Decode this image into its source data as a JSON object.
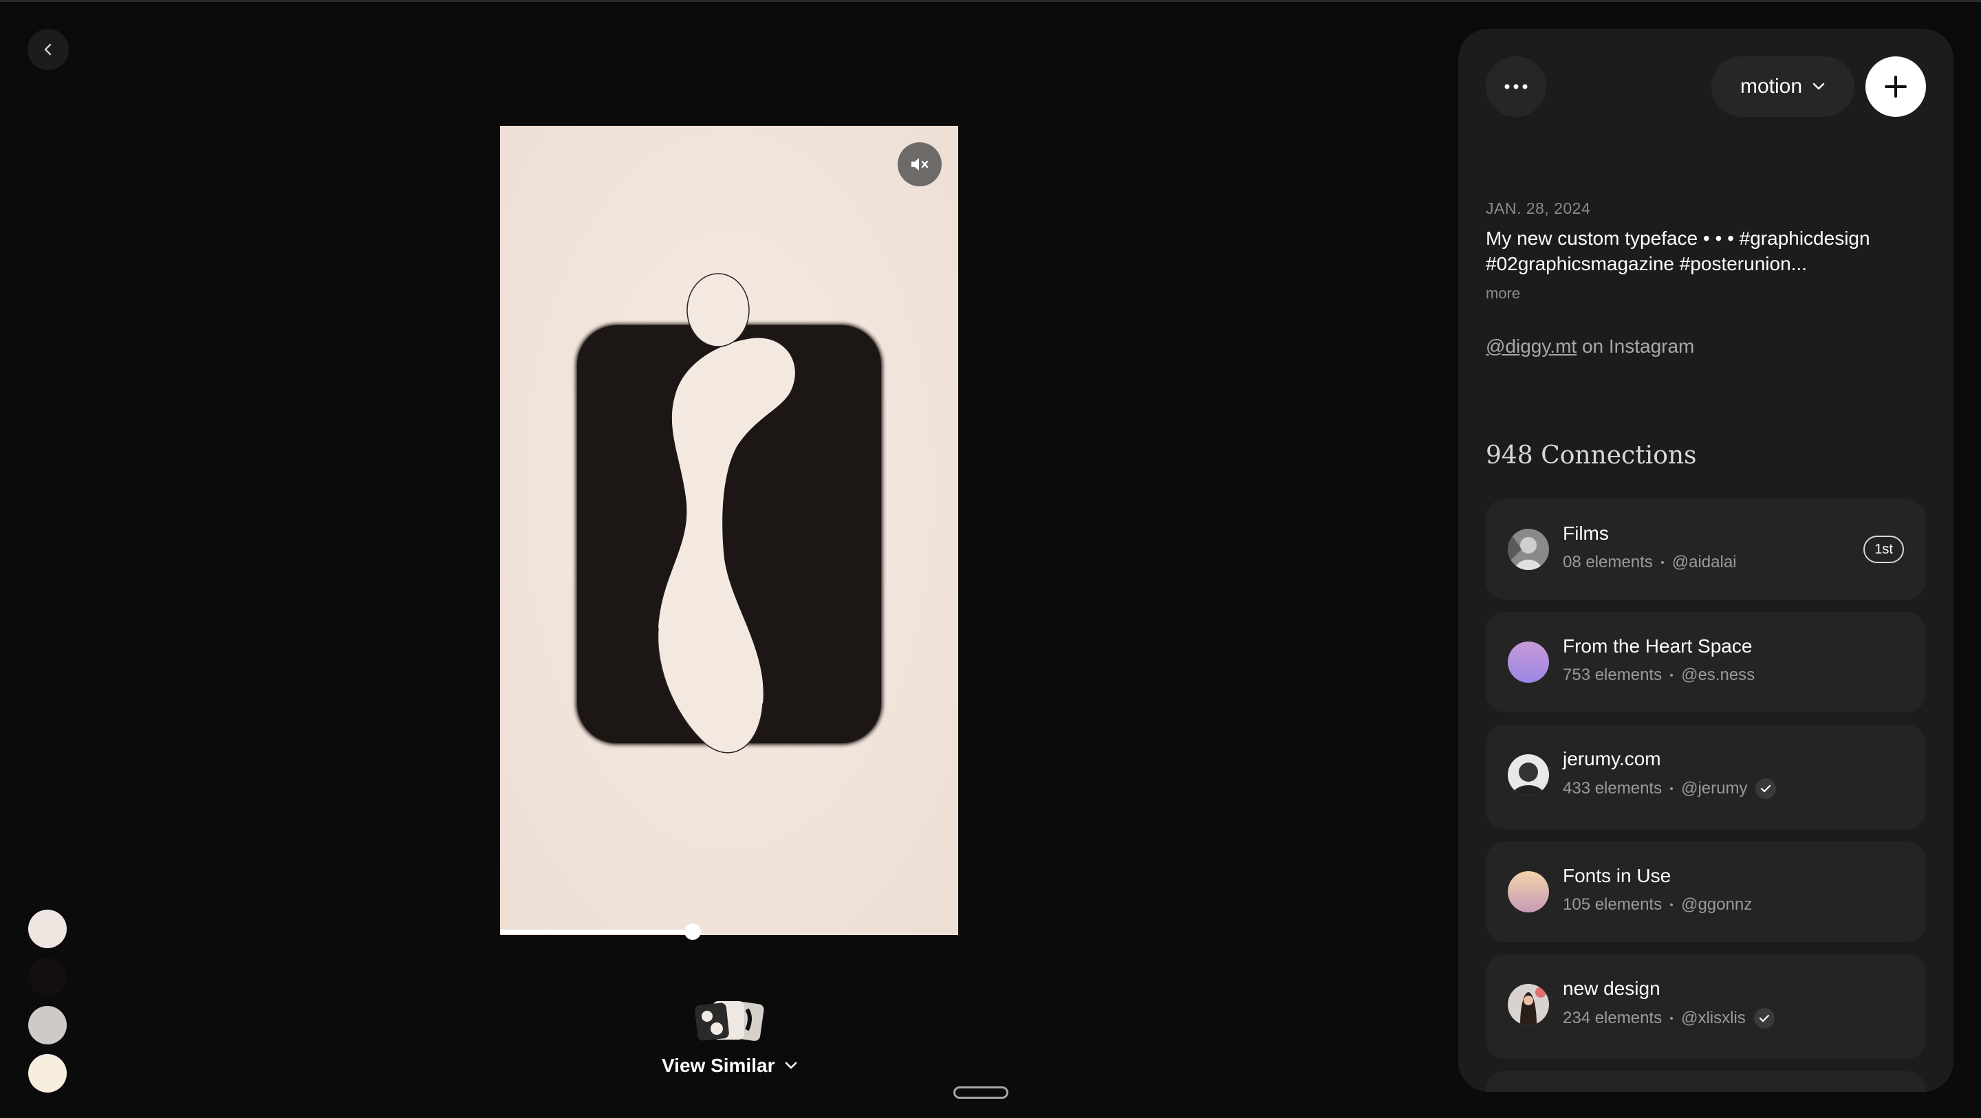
{
  "palette": [
    "#efe6e1",
    "#140f0e",
    "#cfcac6",
    "#f7eedf"
  ],
  "media": {
    "progress_fraction": 0.42
  },
  "view_similar": {
    "label": "View Similar"
  },
  "panel": {
    "board_select_label": "motion",
    "post": {
      "date": "JAN. 28, 2024",
      "caption": "My new custom typeface • • • #graphicdesign #02graphicsmagazine #posterunion...",
      "more_label": "more",
      "source_handle": "@diggy.mt",
      "source_platform": " on Instagram"
    },
    "connections": {
      "title": "948 Connections",
      "items": [
        {
          "name": "Films",
          "count": "08 elements",
          "user": "@aidalai",
          "verified": false,
          "badge": "1st"
        },
        {
          "name": "From the Heart Space",
          "count": "753 elements",
          "user": "@es.ness",
          "verified": false,
          "badge": ""
        },
        {
          "name": "jerumy.com",
          "count": "433 elements",
          "user": "@jerumy",
          "verified": true,
          "badge": ""
        },
        {
          "name": "Fonts in Use",
          "count": "105 elements",
          "user": "@ggonnz",
          "verified": false,
          "badge": ""
        },
        {
          "name": "new design",
          "count": "234 elements",
          "user": "@xlisxlis",
          "verified": true,
          "badge": ""
        }
      ]
    }
  }
}
